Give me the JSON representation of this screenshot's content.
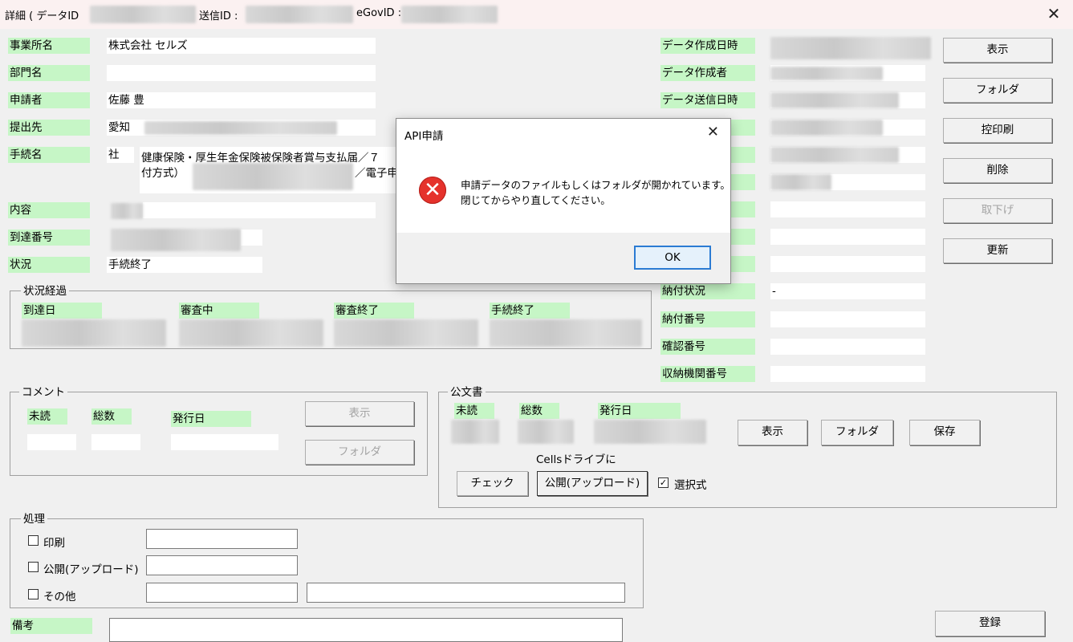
{
  "window": {
    "title_prefix": "詳細 ( データID",
    "send_id_label": "送信ID :",
    "egov_label": "eGovID :",
    "close_glyph": "✕"
  },
  "left_fields": [
    {
      "label": "事業所名",
      "value": "株式会社 セルズ"
    },
    {
      "label": "部門名",
      "value": ""
    },
    {
      "label": "申請者",
      "value": "佐藤 豊"
    },
    {
      "label": "提出先",
      "value": "愛知"
    },
    {
      "label": "手続名",
      "value": "社"
    },
    {
      "label": "内容",
      "value": ""
    },
    {
      "label": "到達番号",
      "value": ""
    },
    {
      "label": "状況",
      "value": "手続終了"
    }
  ],
  "procedure_text": {
    "line1": "健康保険・厚生年金保険被保険者賞与支払届／７",
    "line2": "付方式）",
    "line2b": "／電子申"
  },
  "right_fields": [
    {
      "label": "データ作成日時",
      "value": ""
    },
    {
      "label": "データ作成者",
      "value": ""
    },
    {
      "label": "データ送信日時",
      "value": ""
    },
    {
      "label": "納付状況",
      "value": "-"
    },
    {
      "label": "納付番号",
      "value": ""
    },
    {
      "label": "確認番号",
      "value": ""
    },
    {
      "label": "収納機関番号",
      "value": ""
    }
  ],
  "side_buttons": [
    {
      "label": "表示",
      "disabled": false
    },
    {
      "label": "フォルダ",
      "disabled": false
    },
    {
      "label": "控印刷",
      "disabled": false
    },
    {
      "label": "削除",
      "disabled": false
    },
    {
      "label": "取下げ",
      "disabled": true
    },
    {
      "label": "更新",
      "disabled": false
    }
  ],
  "status_progress": {
    "caption": "状況経過",
    "columns": [
      "到達日",
      "審査中",
      "審査終了",
      "手続終了"
    ]
  },
  "comment": {
    "caption": "コメント",
    "unread": "未読",
    "total": "総数",
    "issue_date": "発行日",
    "show_button": "表示",
    "folder_button": "フォルダ"
  },
  "official_doc": {
    "caption": "公文書",
    "unread": "未読",
    "total": "総数",
    "issue_date": "発行日",
    "show_button": "表示",
    "folder_button": "フォルダ",
    "save_button": "保存",
    "cells_drive_label": "Cellsドライブに",
    "check_button": "チェック",
    "publish_button": "公開(アップロード)",
    "selective_label": "選択式",
    "selective_checked": true
  },
  "processing": {
    "caption": "処理",
    "print_label": "印刷",
    "publish_label": "公開(アップロード)",
    "other_label": "その他"
  },
  "remarks_label": "備考",
  "register_button": "登録",
  "dialog": {
    "title": "API申請",
    "line1": "申請データのファイルもしくはフォルダが開かれています。",
    "line2": "閉じてからやり直してください。",
    "ok": "OK",
    "close_glyph": "✕",
    "icon_glyph": "✕"
  }
}
